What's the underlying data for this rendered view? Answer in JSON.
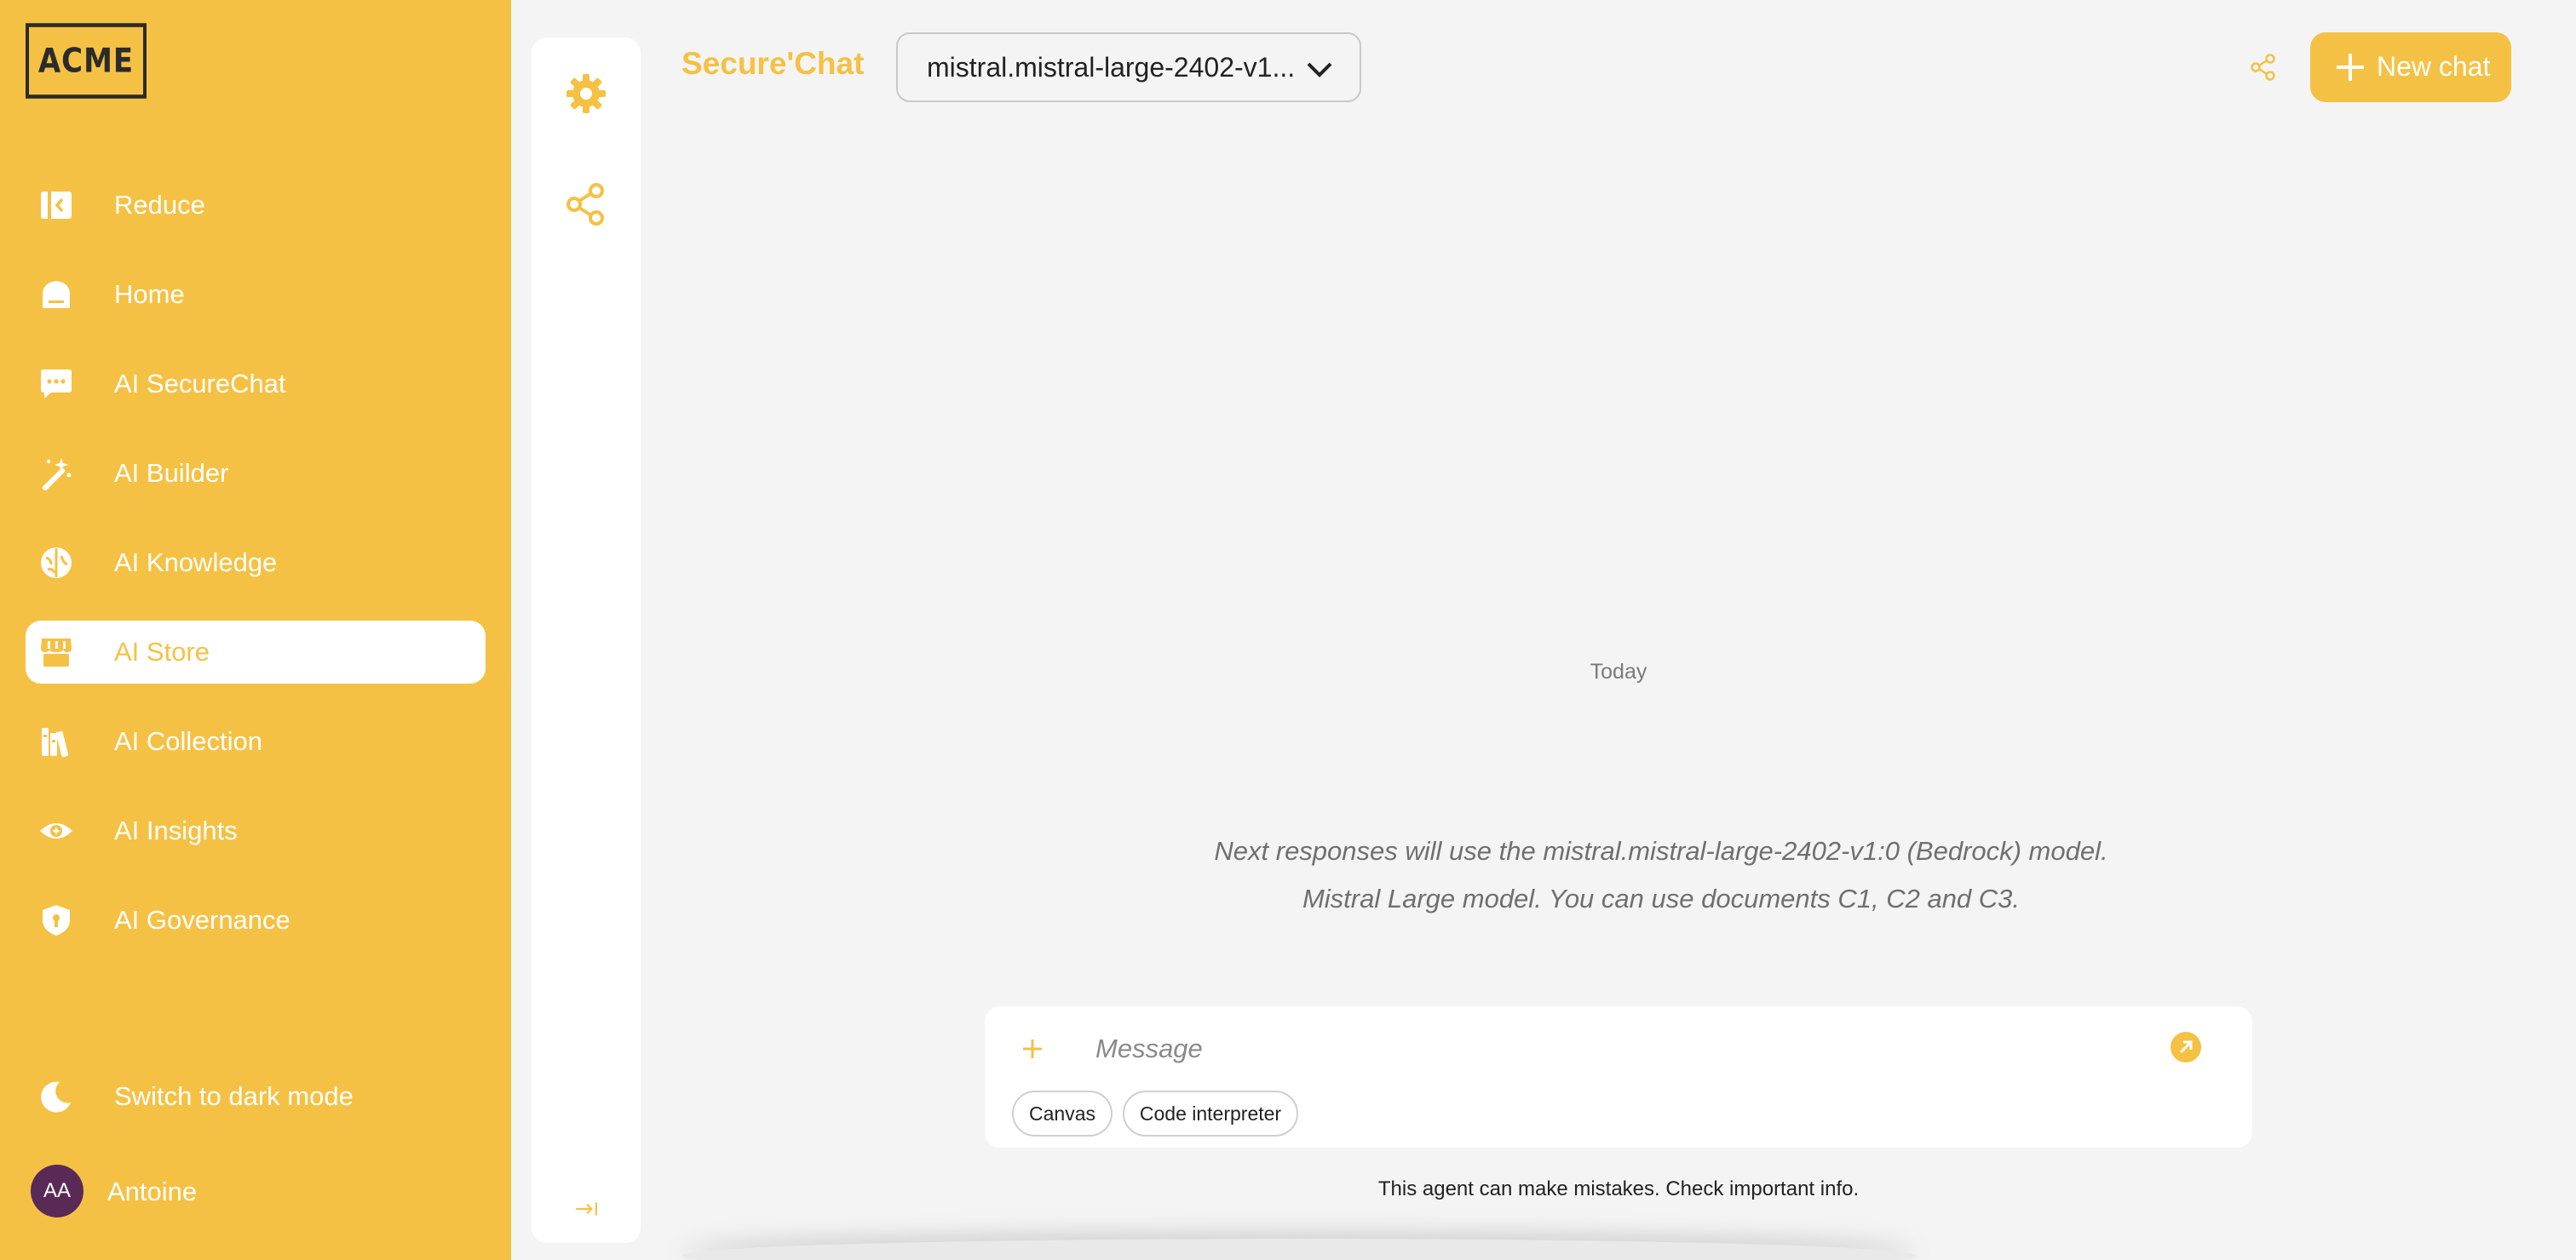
{
  "brand": {
    "logo_text": "ACME",
    "accent_color": "#f5c144"
  },
  "sidebar": {
    "items": [
      {
        "label": "Reduce",
        "icon": "collapse-panel-icon",
        "active": false
      },
      {
        "label": "Home",
        "icon": "home-icon",
        "active": false
      },
      {
        "label": "AI SecureChat",
        "icon": "chat-bubble-icon",
        "active": false
      },
      {
        "label": "AI Builder",
        "icon": "magic-wand-icon",
        "active": false
      },
      {
        "label": "AI Knowledge",
        "icon": "brain-icon",
        "active": false
      },
      {
        "label": "AI Store",
        "icon": "store-icon",
        "active": true
      },
      {
        "label": "AI Collection",
        "icon": "books-icon",
        "active": false
      },
      {
        "label": "AI Insights",
        "icon": "eye-icon",
        "active": false
      },
      {
        "label": "AI Governance",
        "icon": "shield-icon",
        "active": false
      }
    ],
    "dark_mode_label": "Switch to dark mode",
    "user": {
      "initials": "AA",
      "name": "Antoine",
      "avatar_color": "#5a2a57"
    }
  },
  "header": {
    "title": "Secure'Chat",
    "model_selected": "mistral.mistral-large-2402-v1...",
    "new_chat_label": "New chat"
  },
  "chat": {
    "date_separator": "Today",
    "notice_line1": "Next responses will use the mistral.mistral-large-2402-v1:0 (Bedrock) model.",
    "notice_line2": "Mistral Large model. You can use documents C1, C2 and C3."
  },
  "composer": {
    "placeholder": "Message",
    "chips": [
      "Canvas",
      "Code interpreter"
    ],
    "disclaimer": "This agent can make mistakes. Check important info."
  }
}
